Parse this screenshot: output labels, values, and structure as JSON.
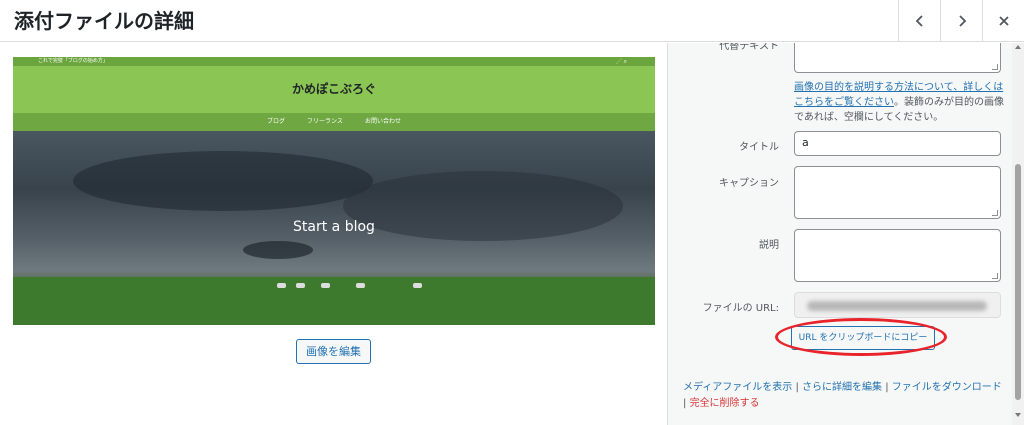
{
  "header": {
    "title": "添付ファイルの詳細",
    "prev_icon": "chevron-left-icon",
    "next_icon": "chevron-right-icon",
    "close_icon": "close-icon"
  },
  "preview": {
    "topbar_text": "これで完璧「ブログの始め方」",
    "site_name": "かめぽこぶろぐ",
    "nav": [
      "ブログ",
      "フリーランス",
      "お問い合わせ"
    ],
    "hero_text": "Start a blog"
  },
  "media": {
    "edit_image_label": "画像を編集"
  },
  "details": {
    "alt_label": "代替テキスト",
    "alt_help_link": "画像の目的を説明する方法について、詳しくはこちらをご覧ください",
    "alt_help_rest": "。装飾のみが目的の画像であれば、空欄にしてください。",
    "title_label": "タイトル",
    "title_value": "a",
    "caption_label": "キャプション",
    "caption_value": "",
    "description_label": "説明",
    "description_value": "",
    "file_url_label": "ファイルの URL:",
    "copy_url_label": "URL をクリップボードにコピー"
  },
  "actions": {
    "view": "メディアファイルを表示",
    "edit_more": "さらに詳細を編集",
    "download": "ファイルをダウンロード",
    "delete": "完全に削除する",
    "sep": " | "
  },
  "colors": {
    "link": "#2271b1",
    "delete": "#d63638",
    "annotation": "#e8232a",
    "site_green": "#8bc553"
  }
}
